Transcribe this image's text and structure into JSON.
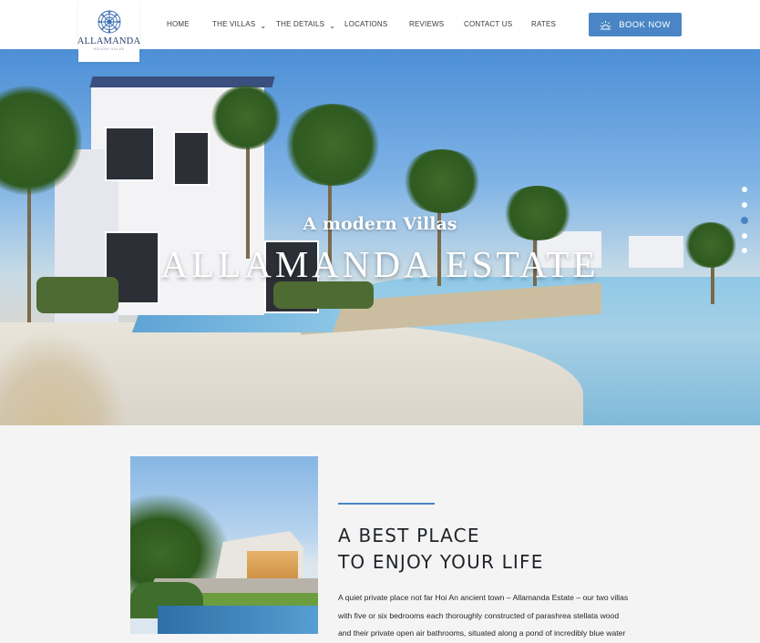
{
  "brand": {
    "name": "ALLAMANDA",
    "tagline": "HOLIDAY VILLAS",
    "accent_color": "#4a86c5"
  },
  "nav": {
    "items": [
      {
        "label": "HOME",
        "has_dropdown": false
      },
      {
        "label": "THE VILLAS",
        "has_dropdown": true
      },
      {
        "label": "THE DETAILS",
        "has_dropdown": true
      },
      {
        "label": "LOCATIONS",
        "has_dropdown": false
      },
      {
        "label": "REVIEWS",
        "has_dropdown": false
      },
      {
        "label": "CONTACT US",
        "has_dropdown": false
      },
      {
        "label": "RATES",
        "has_dropdown": false
      }
    ],
    "book_button": {
      "label": "BOOK NOW",
      "icon": "sunrise-icon"
    }
  },
  "hero": {
    "subtitle": "A modern Villas",
    "title": "ALLAMANDA ESTATE",
    "slider": {
      "total": 5,
      "active_index": 3
    }
  },
  "about": {
    "title_line1": "A BEST PLACE",
    "title_line2": "TO ENJOY YOUR LIFE",
    "body_lines": [
      "A quiet private place not far Hoi An ancient town – Allamanda Estate – our two villas",
      "with five or six bedrooms each thoroughly constructed of parashrea stellata wood",
      "and their private open air bathrooms, situated along a pond of incredibly blue water"
    ]
  }
}
